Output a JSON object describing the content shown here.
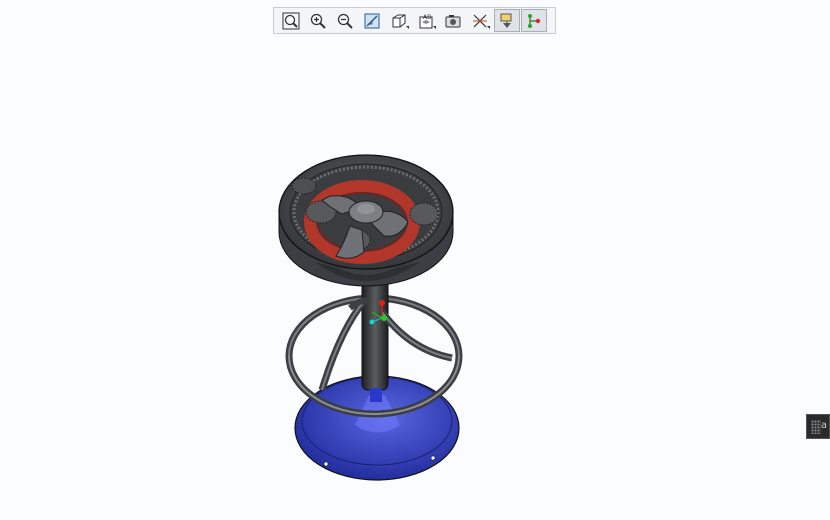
{
  "toolbar": {
    "buttons": [
      {
        "icon": "zoom-fit-icon",
        "active": false
      },
      {
        "icon": "zoom-in-icon",
        "active": false
      },
      {
        "icon": "zoom-out-icon",
        "active": false
      },
      {
        "icon": "repaint-icon",
        "active": false
      },
      {
        "icon": "view-orientation-icon",
        "active": false
      },
      {
        "icon": "saved-views-icon",
        "active": false
      },
      {
        "icon": "display-style-icon",
        "active": false
      },
      {
        "icon": "datum-display-icon",
        "active": false
      },
      {
        "icon": "spin-center-icon",
        "active": true
      },
      {
        "icon": "assembly-connection-icon",
        "active": true
      }
    ]
  },
  "colors": {
    "background": "#fbfcfd",
    "seat_body": "#4a4d50",
    "gear_red": "#b3362b",
    "base_blue": "#3a44b8"
  },
  "side_tab": {
    "icon": "panel-grip-icon",
    "glyph": "a"
  }
}
